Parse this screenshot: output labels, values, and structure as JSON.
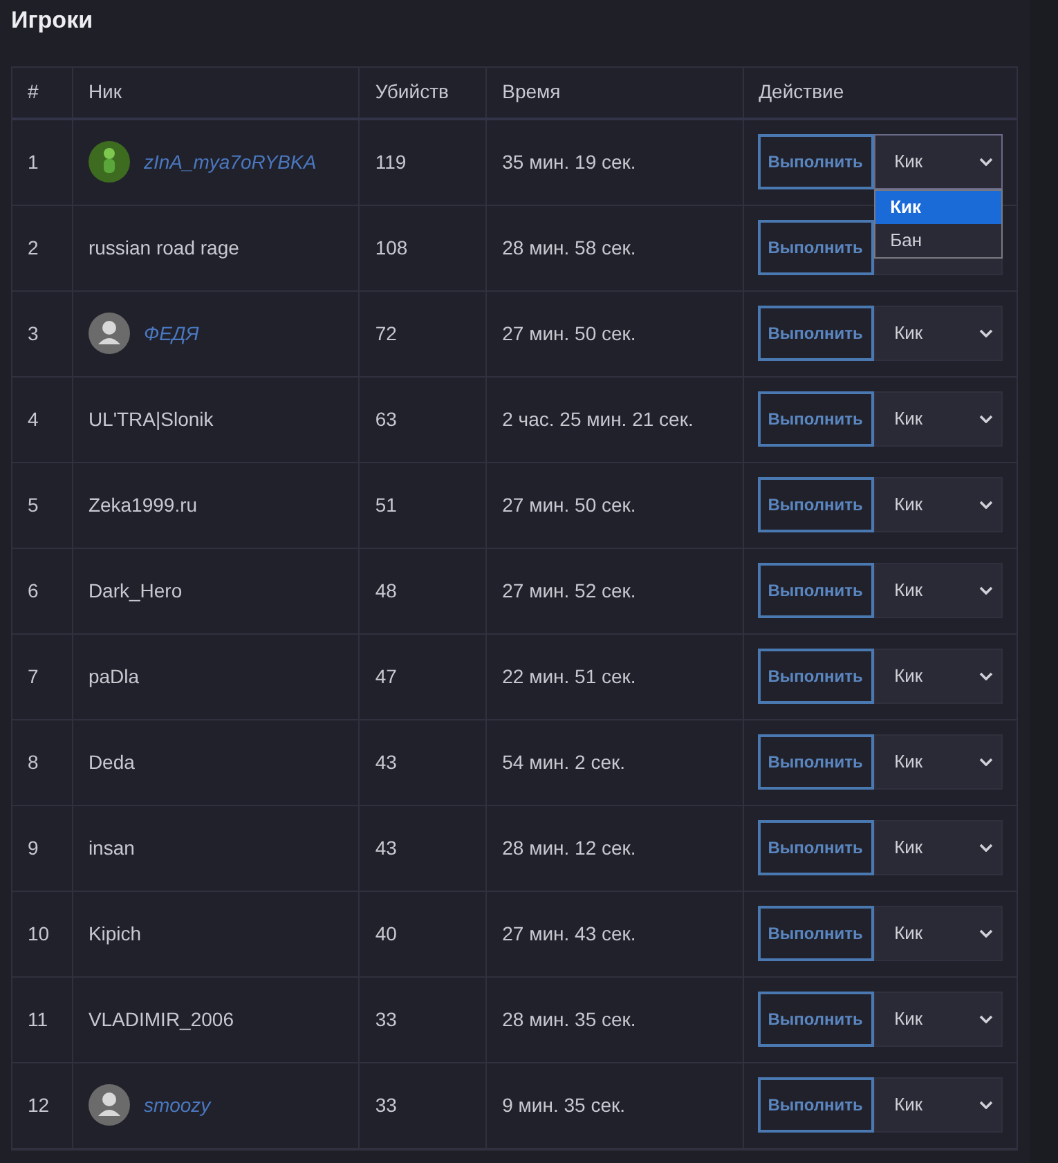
{
  "title": "Игроки",
  "table": {
    "columns": [
      "#",
      "Ник",
      "Убийств",
      "Время",
      "Действие"
    ],
    "rows": [
      {
        "num": "1",
        "nick": "zInA_mya7oRYBKA",
        "kind": "photo",
        "kills": "119",
        "time": "35 мин. 19 сек.",
        "button": "Выполнить",
        "action": "Кик",
        "open": true,
        "options": [
          {
            "label": "Кик",
            "selected": true
          },
          {
            "label": "Бан",
            "selected": false
          }
        ]
      },
      {
        "num": "2",
        "nick": "russian road rage",
        "kind": "plain",
        "kills": "108",
        "time": "28 мин. 58 сек.",
        "button": "Выполнить",
        "open": false
      },
      {
        "num": "3",
        "nick": "ФЕДЯ",
        "kind": "silhouette",
        "kills": "72",
        "time": "27 мин. 50 сек.",
        "button": "Выполнить",
        "action": "Кик",
        "open": false
      },
      {
        "num": "4",
        "nick": "UL'TRA|Slonik",
        "kind": "plain",
        "kills": "63",
        "time": "2 час. 25 мин. 21 сек.",
        "button": "Выполнить",
        "action": "Кик",
        "open": false
      },
      {
        "num": "5",
        "nick": "Zeka1999.ru",
        "kind": "plain",
        "kills": "51",
        "time": "27 мин. 50 сек.",
        "button": "Выполнить",
        "action": "Кик",
        "open": false
      },
      {
        "num": "6",
        "nick": "Dark_Hero",
        "kind": "plain",
        "kills": "48",
        "time": "27 мин. 52 сек.",
        "button": "Выполнить",
        "action": "Кик",
        "open": false
      },
      {
        "num": "7",
        "nick": "paDla",
        "kind": "plain",
        "kills": "47",
        "time": "22 мин. 51 сек.",
        "button": "Выполнить",
        "action": "Кик",
        "open": false
      },
      {
        "num": "8",
        "nick": "Deda",
        "kind": "plain",
        "kills": "43",
        "time": "54 мин. 2 сек.",
        "button": "Выполнить",
        "action": "Кик",
        "open": false
      },
      {
        "num": "9",
        "nick": "insan",
        "kind": "plain",
        "kills": "43",
        "time": "28 мин. 12 сек.",
        "button": "Выполнить",
        "action": "Кик",
        "open": false
      },
      {
        "num": "10",
        "nick": "Kipich",
        "kind": "plain",
        "kills": "40",
        "time": "27 мин. 43 сек.",
        "button": "Выполнить",
        "action": "Кик",
        "open": false
      },
      {
        "num": "11",
        "nick": "VLADIMIR_2006",
        "kind": "plain",
        "kills": "33",
        "time": "28 мин. 35 сек.",
        "button": "Выполнить",
        "action": "Кик",
        "open": false
      },
      {
        "num": "12",
        "nick": "smoozy",
        "kind": "silhouette",
        "kills": "33",
        "time": "9 мин. 35 сек.",
        "button": "Выполнить",
        "action": "Кик",
        "open": false
      }
    ]
  }
}
